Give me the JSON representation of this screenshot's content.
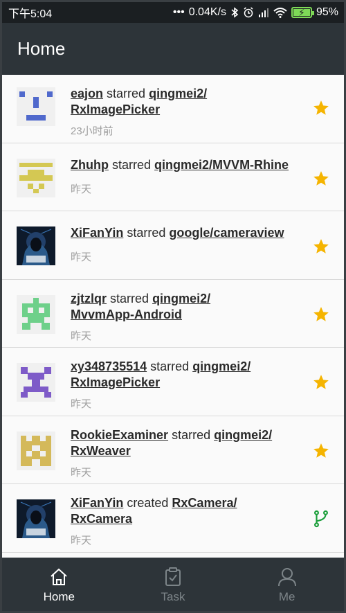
{
  "status_bar": {
    "time": "下午5:04",
    "network_speed": "0.04K/s",
    "battery": "95%"
  },
  "app_bar": {
    "title": "Home"
  },
  "feed": [
    {
      "user": "eajon",
      "verb": "starred",
      "repo_line1": "qingmei2/",
      "repo_line2": "RxImagePicker",
      "time": "23小时前",
      "action": "star"
    },
    {
      "user": "Zhuhp",
      "verb": "starred",
      "repo_line1": "qingmei2/MVVM-Rhine",
      "repo_line2": "",
      "time": "昨天",
      "action": "star"
    },
    {
      "user": "XiFanYin",
      "verb": "starred",
      "repo_line1": "google/cameraview",
      "repo_line2": "",
      "time": "昨天",
      "action": "star"
    },
    {
      "user": "zjtzlqr",
      "verb": "starred",
      "repo_line1": "qingmei2/",
      "repo_line2": "MvvmApp-Android",
      "time": "昨天",
      "action": "star"
    },
    {
      "user": "xy348735514",
      "verb": "starred",
      "repo_line1": "qingmei2/",
      "repo_line2": "RxImagePicker",
      "time": "昨天",
      "action": "star"
    },
    {
      "user": "RookieExaminer",
      "verb": "starred",
      "repo_line1": "qingmei2/",
      "repo_line2": "RxWeaver",
      "time": "昨天",
      "action": "star"
    },
    {
      "user": "XiFanYin",
      "verb": "created",
      "repo_line1": "RxCamera/",
      "repo_line2": "RxCamera",
      "time": "昨天",
      "action": "fork"
    }
  ],
  "bottom_nav": [
    {
      "label": "Home",
      "icon": "home-icon",
      "active": true
    },
    {
      "label": "Task",
      "icon": "task-icon",
      "active": false
    },
    {
      "label": "Me",
      "icon": "person-icon",
      "active": false
    }
  ],
  "colors": {
    "star": "#f5b400",
    "fork": "#1a9e3a",
    "app_bar": "#2d3439"
  }
}
